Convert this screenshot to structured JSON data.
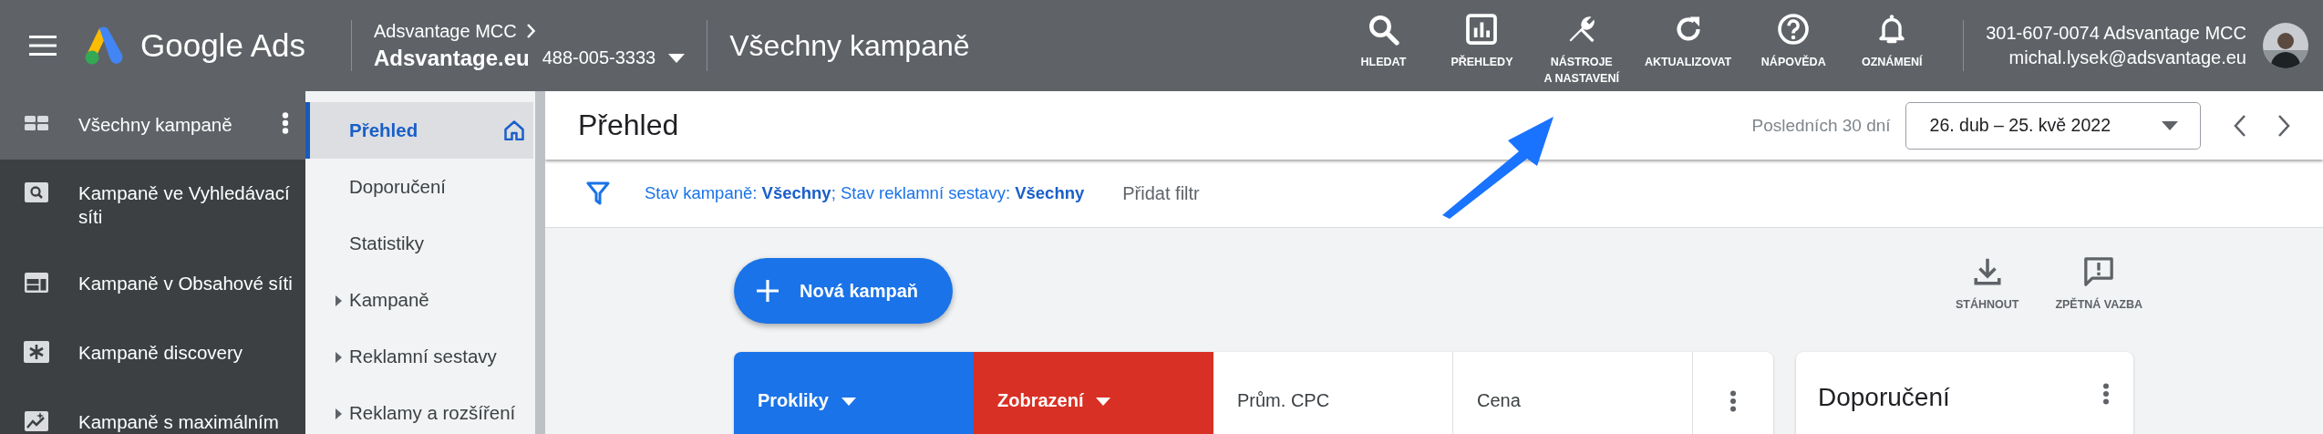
{
  "topbar": {
    "product": "Google Ads",
    "account_parent": "Adsvantage MCC",
    "account_name": "Adsvantage.eu",
    "account_id": "488-005-3333",
    "page_title": "Všechny kampaně",
    "tools": [
      {
        "kind": "search",
        "label": "HLEDAT"
      },
      {
        "kind": "reports",
        "label": "PŘEHLEDY"
      },
      {
        "kind": "tools",
        "label": "NÁSTROJE\nA NASTAVENÍ"
      },
      {
        "kind": "refresh",
        "label": "AKTUALIZOVAT"
      },
      {
        "kind": "help",
        "label": "NÁPOVĚDA"
      },
      {
        "kind": "notifications",
        "label": "OZNÁMENÍ"
      }
    ],
    "user_line": "301-607-0074 Adsvantage MCC",
    "user_email": "michal.lysek@adsvantage.eu"
  },
  "nav": [
    {
      "kind": "all",
      "label": "Všechny kampaně",
      "selected": true
    },
    {
      "kind": "search",
      "label": "Kampaně ve Vyhledávací síti",
      "selected": false
    },
    {
      "kind": "display",
      "label": "Kampaně v Obsahové síti",
      "selected": false
    },
    {
      "kind": "discovery",
      "label": "Kampaně discovery",
      "selected": false
    },
    {
      "kind": "performance",
      "label": "Kampaně s maximálním",
      "selected": false
    }
  ],
  "subnav": [
    {
      "kind": "home",
      "label": "Přehled",
      "selected": true
    },
    {
      "kind": "page",
      "label": "Doporučení",
      "selected": false
    },
    {
      "kind": "page",
      "label": "Statistiky",
      "selected": false
    },
    {
      "kind": "section",
      "label": "Kampaně",
      "selected": false
    },
    {
      "kind": "section",
      "label": "Reklamní sestavy",
      "selected": false
    },
    {
      "kind": "section",
      "label": "Reklamy a rozšíření",
      "selected": false
    }
  ],
  "main": {
    "title": "Přehled",
    "date_range_label": "Posledních 30 dní",
    "date_range": "26. dub – 25. kvě 2022",
    "filter": "Stav kampaně: **Všechny**; Stav reklamní sestavy: **Všechny**",
    "add_filter": "Přidat filtr",
    "new_campaign": "Nová kampaň",
    "actions": [
      {
        "kind": "download",
        "label": "STÁHNOUT"
      },
      {
        "kind": "feedback",
        "label": "ZPĚTNÁ VAZBA"
      }
    ],
    "metrics": [
      {
        "label": "Prokliky",
        "selected": true,
        "color": "#1a73e8"
      },
      {
        "label": "Zobrazení",
        "selected": true,
        "color": "#d93025"
      },
      {
        "label": "Prům. CPC",
        "selected": false
      },
      {
        "label": "Cena",
        "selected": false
      }
    ],
    "recommendations_title": "Doporučení"
  }
}
